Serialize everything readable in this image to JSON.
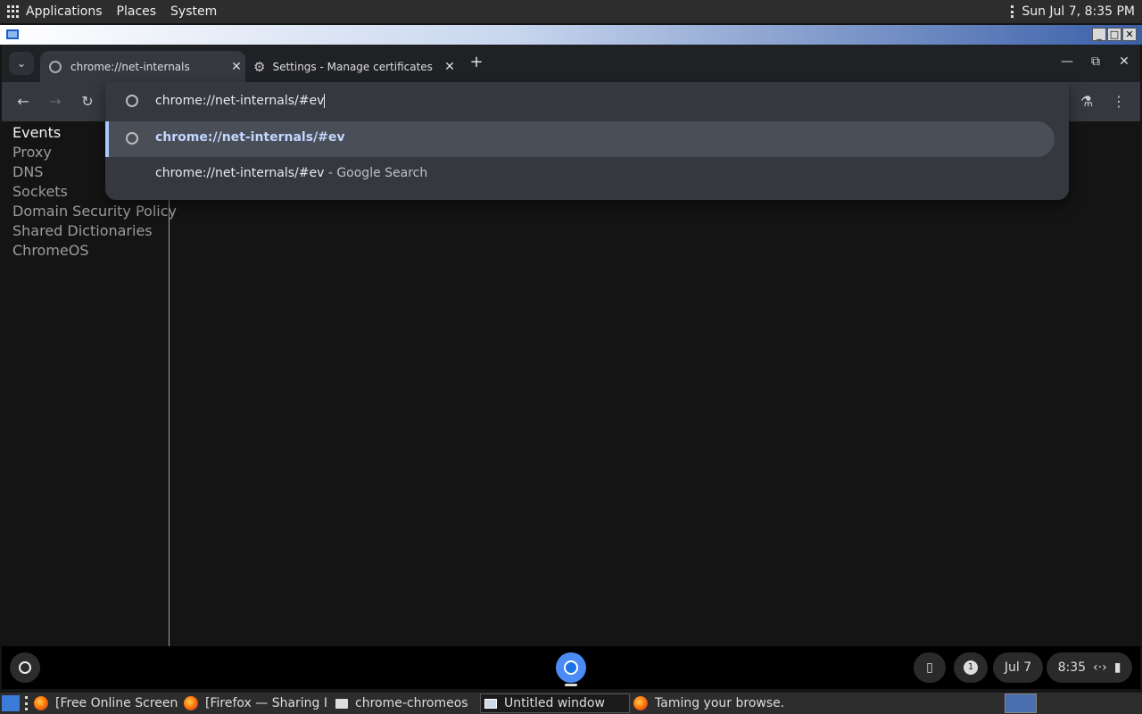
{
  "top_panel": {
    "menus": [
      "Applications",
      "Places",
      "System"
    ],
    "clock": "Sun Jul  7,  8:35 PM"
  },
  "tabs": [
    {
      "title": "chrome://net-internals",
      "active": true
    },
    {
      "title": "Settings - Manage certificates",
      "active": false
    }
  ],
  "omnibox": {
    "text": "chrome://net-internals/#ev"
  },
  "suggestions": [
    {
      "text": "chrome://net-internals/#ev",
      "type": "url"
    },
    {
      "text": "chrome://net-internals/#ev",
      "suffix": " - Google Search",
      "type": "search"
    }
  ],
  "sidebar": {
    "items": [
      "Events",
      "Proxy",
      "DNS",
      "Sockets",
      "Domain Security Policy",
      "Shared Dictionaries",
      "ChromeOS"
    ],
    "selected": "Events"
  },
  "shelf": {
    "date": "Jul 7",
    "time": "8:35",
    "notification_count": "1"
  },
  "taskbar": {
    "items": [
      "[Free Online Screen ...",
      "[Firefox — Sharing I...",
      "chrome-chromeos",
      "Untitled window",
      "Taming your browse..."
    ]
  },
  "colors": {
    "accent": "#a8c7fa",
    "page_bg": "#141414"
  }
}
